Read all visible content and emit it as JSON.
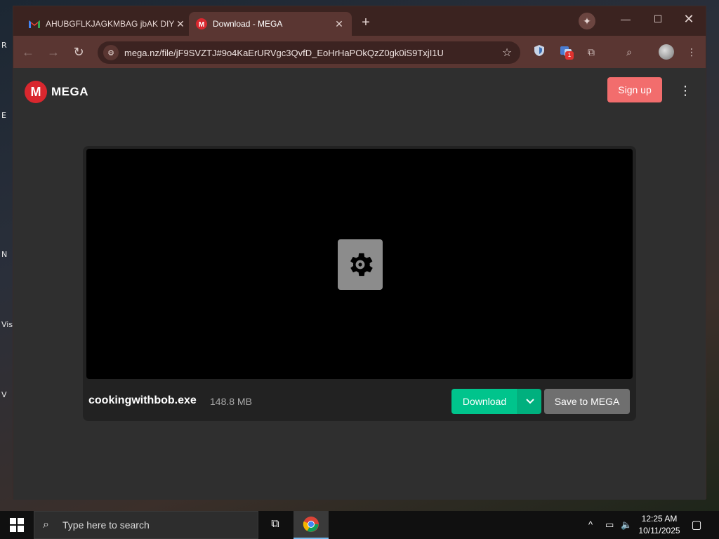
{
  "desktop": {
    "labels": [
      "R",
      "E",
      "N",
      "Vis",
      "V"
    ]
  },
  "browser": {
    "tabs": [
      {
        "title": "AHUBGFLKJAGKMBAG jbAK DIY",
        "favicon": "gmail-icon",
        "close": "✕"
      },
      {
        "title": "Download - MEGA",
        "favicon": "mega-icon",
        "close": "✕"
      }
    ],
    "new_tab": "+",
    "window_controls": {
      "minimize": "—",
      "maximize": "☐",
      "close": "✕"
    },
    "address_bar": {
      "url": "mega.nz/file/jF9SVZTJ#9o4KaErURVgc3QvfD_EoHrHaPOkQzZ0gk0iS9TxjI1U"
    },
    "extension_badge": "1"
  },
  "page": {
    "brand": {
      "letter": "M",
      "name": "MEGA"
    },
    "signup_label": "Sign up",
    "file": {
      "name": "cookingwithbob.exe",
      "size": "148.8 MB"
    },
    "download_label": "Download",
    "save_label": "Save to MEGA"
  },
  "taskbar": {
    "search_placeholder": "Type here to search",
    "time": "12:25 AM",
    "date": "10/11/2025"
  },
  "colors": {
    "mega_red": "#d9272e",
    "signup": "#f26d6d",
    "download_green": "#00c48c",
    "save_gray": "#6f6f6f"
  }
}
